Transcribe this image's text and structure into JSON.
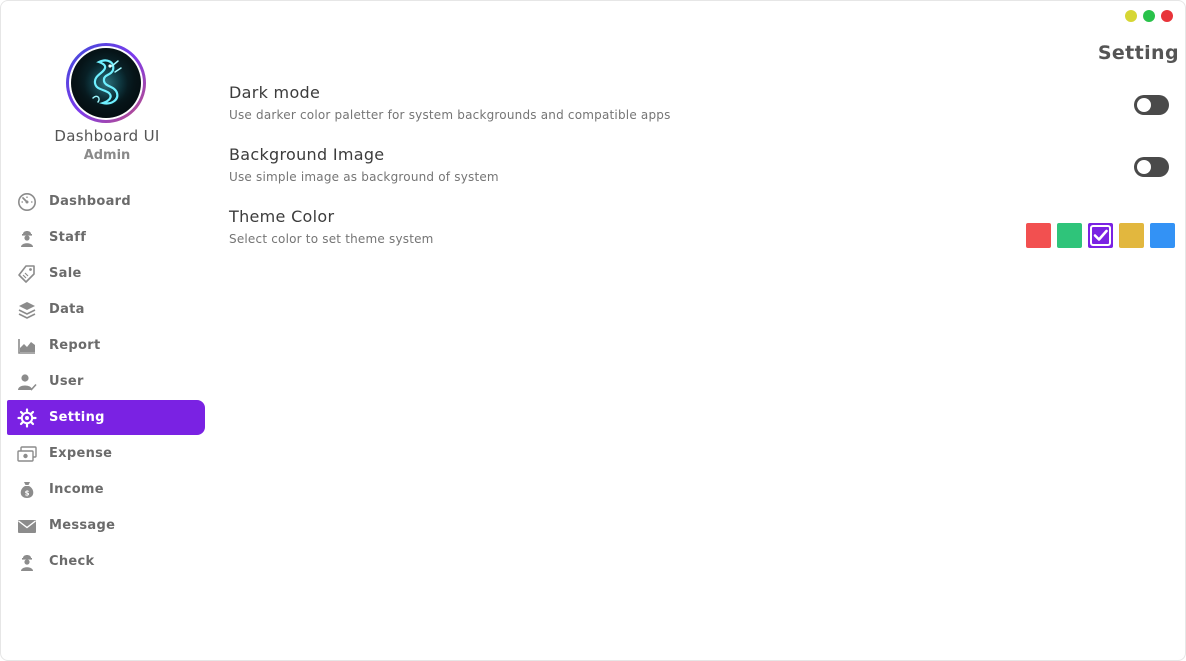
{
  "window": {
    "controls": [
      {
        "name": "minimize",
        "color": "#d6d634"
      },
      {
        "name": "maximize",
        "color": "#29c24a"
      },
      {
        "name": "close",
        "color": "#e8343a"
      }
    ]
  },
  "profile": {
    "name": "Dashboard UI",
    "role": "Admin"
  },
  "sidebar": {
    "active_color": "#7a22e3",
    "items": [
      {
        "label": "Dashboard",
        "icon": "speedometer-icon"
      },
      {
        "label": "Staff",
        "icon": "staff-person-icon"
      },
      {
        "label": "Sale",
        "icon": "price-tag-icon"
      },
      {
        "label": "Data",
        "icon": "layers-stack-icon"
      },
      {
        "label": "Report",
        "icon": "area-chart-icon"
      },
      {
        "label": "User",
        "icon": "user-check-icon"
      },
      {
        "label": "Setting",
        "icon": "gear-icon",
        "active": true
      },
      {
        "label": "Expense",
        "icon": "money-bill-icon"
      },
      {
        "label": "Income",
        "icon": "money-bag-icon"
      },
      {
        "label": "Message",
        "icon": "envelope-icon"
      },
      {
        "label": "Check",
        "icon": "staff-person-icon"
      }
    ]
  },
  "page": {
    "title": "Setting"
  },
  "settings": {
    "dark_mode": {
      "title": "Dark mode",
      "description": "Use darker color paletter for system backgrounds and compatible apps",
      "enabled": false
    },
    "background_image": {
      "title": "Background Image",
      "description": "Use simple image as background of system",
      "enabled": false
    },
    "theme_color": {
      "title": "Theme Color",
      "description": "Select color to set theme system",
      "colors": [
        "#f25050",
        "#2fc47a",
        "#7a22e3",
        "#e2b73e",
        "#3392f5"
      ],
      "selected": "#7a22e3"
    }
  }
}
